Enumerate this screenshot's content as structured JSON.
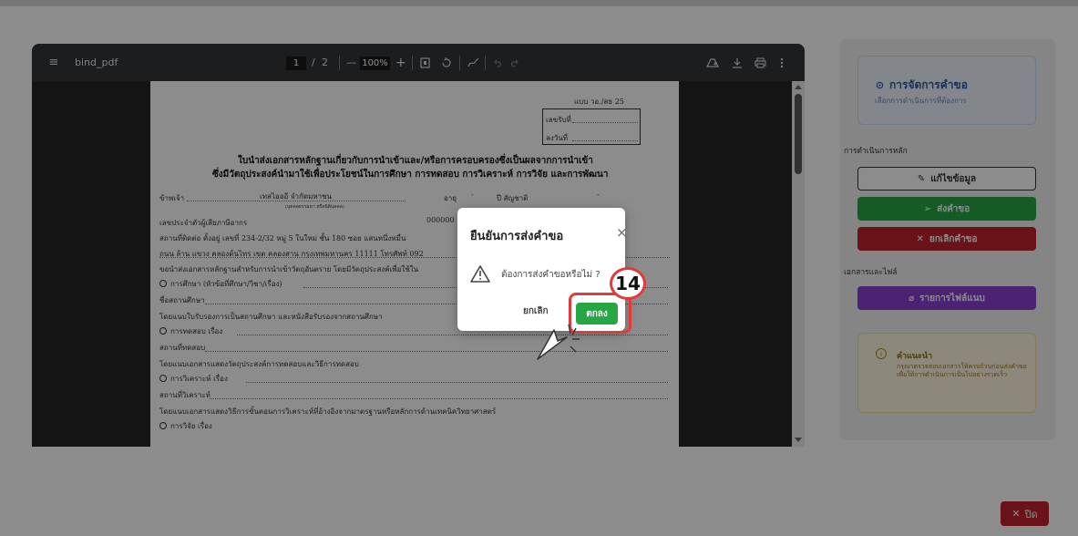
{
  "viewer": {
    "filename": "bind_pdf",
    "page_current": "1",
    "page_sep": "/",
    "page_total": "2",
    "zoom": "100%",
    "minus": "—",
    "plus": "+"
  },
  "doc": {
    "form_code": "แบบ วอ./สธ 25",
    "recv_no": "เลขรับที่",
    "recv_date": "ลงวันที่",
    "title1": "ใบนำส่งเอกสารหลักฐานเกี่ยวกับการนำเข้าและ/หรือการครอบครองซึ่งเป็นผลจากการนำเข้า",
    "title2": "ซึ่งมีวัตถุประสงค์นำมาใช้เพื่อประโยชน์ในการศึกษา การทดสอบ การวิเคราะห์ การวิจัย และการพัฒนา",
    "line1a": "ข้าพเจ้า",
    "line1b": "เทสไอออี จำกัดมหาชน",
    "line1c": "อายุ",
    "line1d": "-",
    "line1e": "ปี สัญชาติ",
    "line1f": "-",
    "line1note": "(บุคคลธรรมดา หรือนิติบุคคล)",
    "line2": "เลขประจำตัวผู้เสียภาษีอากร",
    "line2b": "000000",
    "line3": "สถานที่ติดต่อ ตั้งอยู่ เลขที่    234-2/32 หมู่ 5   ในใหม่ ชั้น 180 ซอย แสนหนึ่งหมื่น",
    "line4": "ถนน ล้าน แขวง คลองต้นไทร เขต คลองสาน กรุงเทพมหานคร 11111 โทรศัพท์ 092",
    "line5": "ขอนำส่งเอกสารหลักฐานสำหรับการนำเข้าวัตถุอันตราย โดยมีวัตถุประสงค์เพื่อใช้ใน",
    "line6": "การศึกษา (หัวข้อที่ศึกษา/วิชา/เรื่อง)",
    "line7": "ชื่อสถานศึกษา",
    "line8": "โดยแนบใบรับรองการเป็นสถานศึกษา และหนังสือรับรองจากสถานศึกษา",
    "line9": "การทดสอบ เรื่อง",
    "line10": "สถานที่ทดสอบ",
    "line11": "โดยแนบเอกสารแสดงวัตถุประสงค์การทดสอบและวิธีการทดสอบ",
    "line12": "การวิเคราะห์ เรื่อง",
    "line13": "สถานที่วิเคราะห์",
    "line14": "โดยแนบเอกสารแสดงวิธีการขั้นตอนการวิเคราะห์ที่อ้างอิงจากมาตรฐานหรือหลักการด้านเทคนิควิทยาศาสตร์",
    "line15": "การวิจัย เรื่อง"
  },
  "panel": {
    "card_title": "การจัดการคำขอ",
    "card_sub": "เลือกการดำเนินการที่ต้องการ",
    "main_actions_label": "การดำเนินการหลัก",
    "edit_label": "แก้ไขข้อมูล",
    "submit_label": "ส่งคำขอ",
    "cancel_label": "ยกเลิกคำขอ",
    "docs_label": "เอกสารและไฟล์",
    "attach_label": "รายการไฟล์แนบ",
    "hint_title": "คำแนะนำ",
    "hint_body": "กรุณาตรวจสอบเอกสารให้ครบถ้วนก่อนส่งคำขอ เพื่อให้การดำเนินการเป็นไปอย่างรวดเร็ว"
  },
  "footer": {
    "close_label": "ปิด"
  },
  "dialog": {
    "title": "ยืนยันการส่งคำขอ",
    "message": "ต้องการส่งคำขอหรือไม่ ?",
    "cancel": "ยกเลิก",
    "ok": "ตกลง"
  },
  "annotation": {
    "step": "14"
  },
  "colors": {
    "green": "#27a744",
    "red": "#c0242f",
    "purple": "#8b3fd4",
    "blue": "#2d5aa6",
    "highlight": "#e23a3a"
  }
}
